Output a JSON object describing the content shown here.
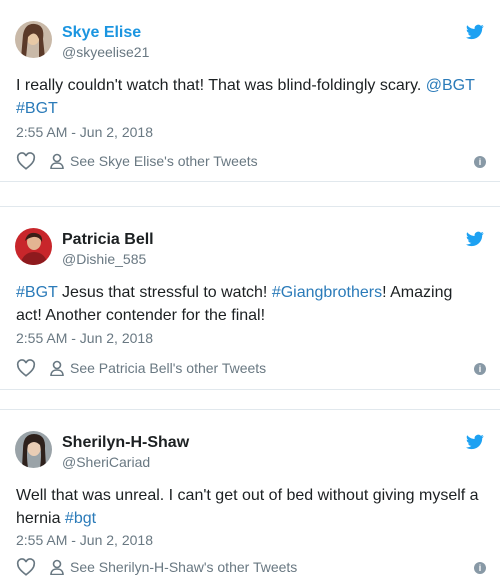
{
  "tweets": [
    {
      "name": "Skye Elise",
      "handle": "@skyeelise21",
      "segments": [
        {
          "text": "I really couldn't watch that! That was blind-foldingly scary. ",
          "link": false
        },
        {
          "text": "@BGT",
          "link": true
        },
        {
          "text": " ",
          "link": false
        },
        {
          "text": "#BGT",
          "link": true
        }
      ],
      "time": "2:55 AM - Jun 2, 2018",
      "other_tweets": "See Skye Elise's other Tweets"
    },
    {
      "name": "Patricia Bell",
      "handle": "@Dishie_585",
      "segments": [
        {
          "text": "#BGT",
          "link": true
        },
        {
          "text": " Jesus that stressful to watch! ",
          "link": false
        },
        {
          "text": "#Giangbrothers",
          "link": true
        },
        {
          "text": "! Amazing act! Another contender for the final!",
          "link": false
        }
      ],
      "time": "2:55 AM - Jun 2, 2018",
      "other_tweets": "See Patricia Bell's other Tweets"
    },
    {
      "name": "Sherilyn-H-Shaw",
      "handle": "@SheriCariad",
      "segments": [
        {
          "text": "Well that was unreal. I can't get out of bed without giving myself a hernia ",
          "link": false
        },
        {
          "text": "#bgt",
          "link": true
        }
      ],
      "time": "2:55 AM - Jun 2, 2018",
      "other_tweets": "See Sherilyn-H-Shaw's other Tweets"
    }
  ],
  "colors": {
    "link": "#2b7bb9",
    "brand": "#1da1f2",
    "muted": "#697882"
  },
  "icons": {
    "brand": "twitter-bird-icon",
    "like": "heart-icon",
    "profile": "person-icon",
    "info": "info-icon"
  }
}
